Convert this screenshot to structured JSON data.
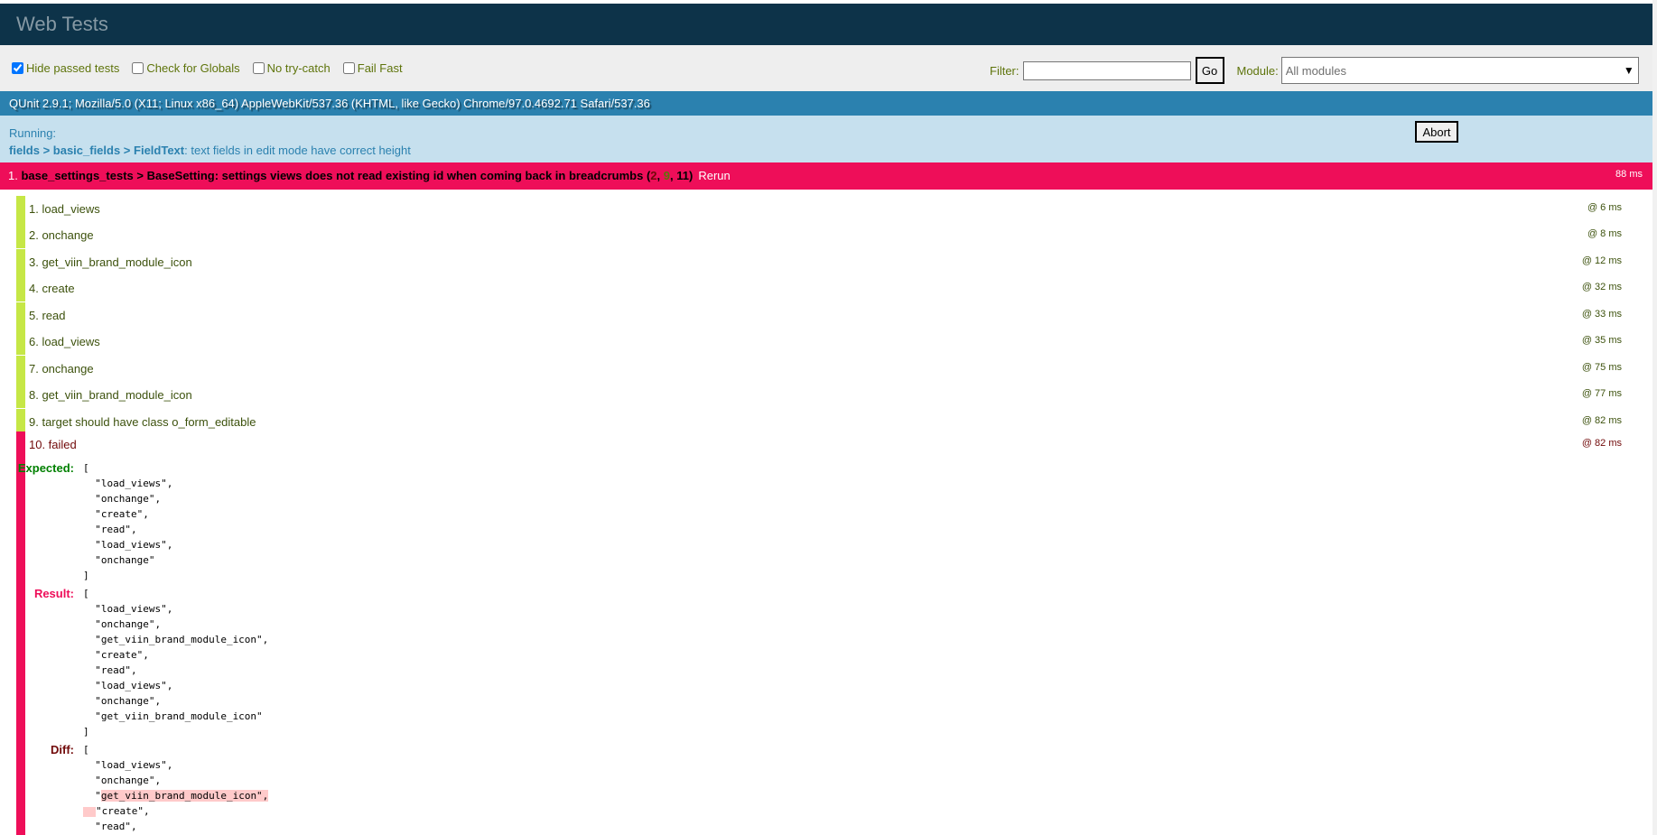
{
  "header": {
    "title": "Web Tests"
  },
  "toolbar": {
    "options": [
      {
        "label": "Hide passed tests",
        "checked": true
      },
      {
        "label": "Check for Globals",
        "checked": false
      },
      {
        "label": "No try-catch",
        "checked": false
      },
      {
        "label": "Fail Fast",
        "checked": false
      }
    ],
    "filter_label": "Filter:",
    "filter_value": "",
    "go_label": "Go",
    "module_label": "Module:",
    "module_value": "All modules"
  },
  "user_agent": "QUnit 2.9.1; Mozilla/5.0 (X11; Linux x86_64) AppleWebKit/537.36 (KHTML, like Gecko) Chrome/97.0.4692.71 Safari/537.36",
  "running": {
    "label": "Running:",
    "module": "fields > basic_fields > FieldText",
    "test": ": text fields in edit mode have correct height",
    "abort_label": "Abort"
  },
  "failed_test": {
    "index": "1.",
    "module": "base_settings_tests > BaseSetting:",
    "name": "settings views does not read existing id when coming back in breadcrumbs",
    "failed_count": "2",
    "passed_count": "9",
    "total_count": "11",
    "rerun_label": "Rerun",
    "time": "88 ms",
    "assertions": [
      {
        "label": "1. load_views",
        "time": "@ 6 ms"
      },
      {
        "label": "2. onchange",
        "time": "@ 8 ms"
      },
      {
        "label": "3. get_viin_brand_module_icon",
        "time": "@ 12 ms"
      },
      {
        "label": "4. create",
        "time": "@ 32 ms"
      },
      {
        "label": "5. read",
        "time": "@ 33 ms"
      },
      {
        "label": "6. load_views",
        "time": "@ 35 ms"
      },
      {
        "label": "7. onchange",
        "time": "@ 75 ms"
      },
      {
        "label": "8. get_viin_brand_module_icon",
        "time": "@ 77 ms"
      },
      {
        "label": "9. target should have class o_form_editable",
        "time": "@ 82 ms"
      }
    ],
    "failed_assertion": {
      "label": "10. failed",
      "time": "@ 82 ms",
      "expected_label": "Expected:",
      "expected": "[\n  \"load_views\",\n  \"onchange\",\n  \"create\",\n  \"read\",\n  \"load_views\",\n  \"onchange\"\n]",
      "result_label": "Result:",
      "result": "[\n  \"load_views\",\n  \"onchange\",\n  \"get_viin_brand_module_icon\",\n  \"create\",\n  \"read\",\n  \"load_views\",\n  \"onchange\",\n  \"get_viin_brand_module_icon\"\n]",
      "diff_label": "Diff:",
      "diff": {
        "line1": "[",
        "line2": "  \"load_views\",",
        "line3": "  \"onchange\",",
        "line4_prefix": "  \"",
        "line4_del": "get_viin_brand_module_icon\",",
        "line5": "\"create\",",
        "line6": "  \"read\","
      }
    }
  }
}
